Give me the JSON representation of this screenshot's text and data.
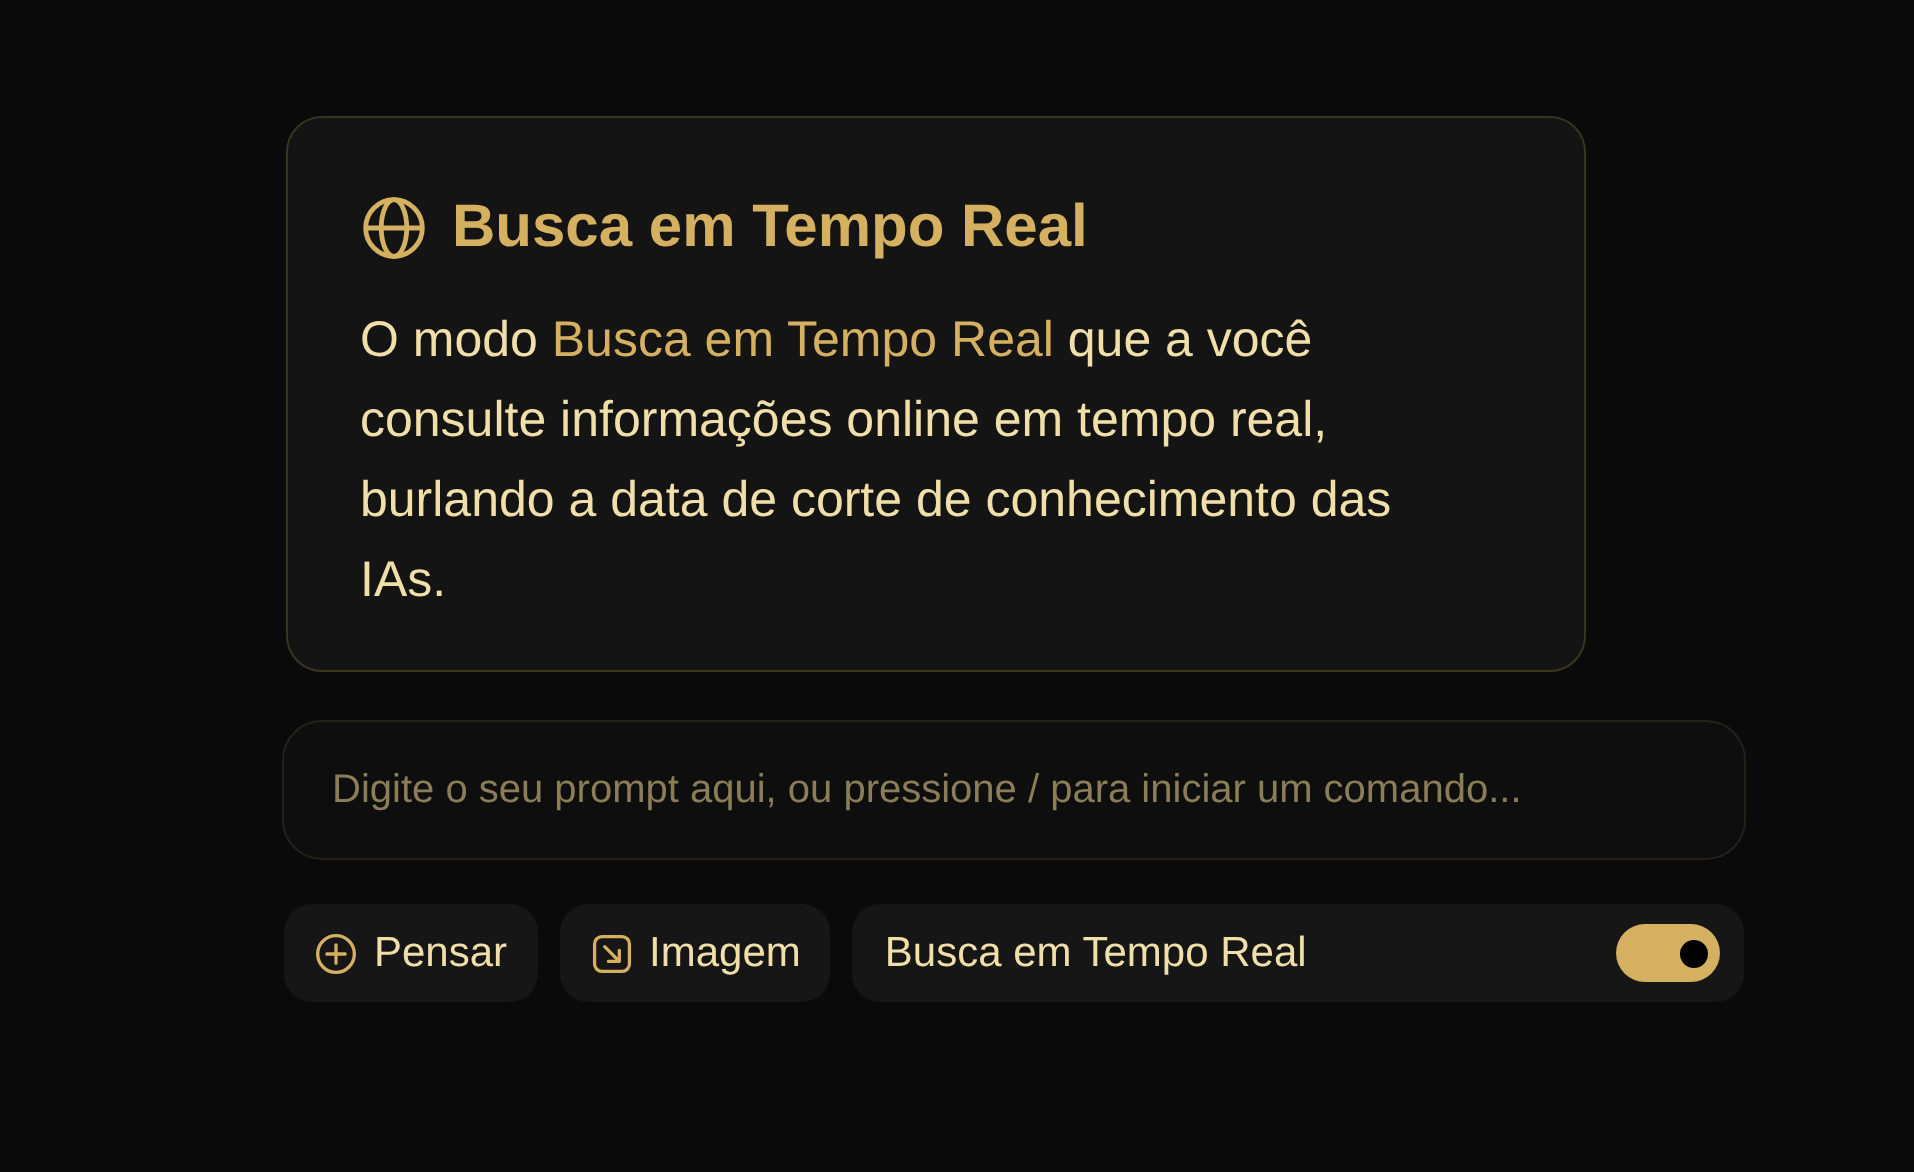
{
  "info_card": {
    "title": "Busca em Tempo Real",
    "text": "O modo *Busca em Tempo Real* que a você consulte informações online em tempo real, burlando a data de corte de conhecimento das IAs."
  },
  "prompt": {
    "placeholder": "Digite o seu prompt aqui, ou pressione / para iniciar um comando..."
  },
  "actions": [
    {
      "kind": "think",
      "label": "Pensar"
    },
    {
      "kind": "image",
      "label": "Imagem"
    },
    {
      "kind": "toggle",
      "label": "Busca em Tempo Real",
      "on": true
    }
  ]
}
